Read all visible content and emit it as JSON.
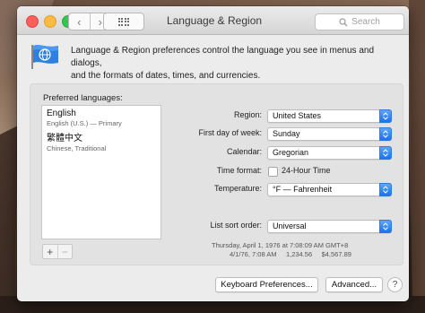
{
  "window": {
    "title": "Language & Region"
  },
  "titlebar": {
    "back_glyph": "‹",
    "forward_glyph": "›",
    "search_placeholder": "Search"
  },
  "intro": {
    "line1": "Language & Region preferences control the language you see in menus and dialogs,",
    "line2": "and the formats of dates, times, and currencies."
  },
  "preferred_languages": {
    "title": "Preferred languages:",
    "items": [
      {
        "name": "English",
        "detail": "English (U.S.) — Primary"
      },
      {
        "name": "繁體中文",
        "detail": "Chinese, Traditional"
      }
    ],
    "add_label": "+",
    "remove_label": "−"
  },
  "settings": {
    "region_label": "Region:",
    "region_value": "United States",
    "first_day_label": "First day of week:",
    "first_day_value": "Sunday",
    "calendar_label": "Calendar:",
    "calendar_value": "Gregorian",
    "time_format_label": "Time format:",
    "time_format_checkbox": "24-Hour Time",
    "time_format_checked": false,
    "temperature_label": "Temperature:",
    "temperature_value": "°F — Fahrenheit",
    "sort_order_label": "List sort order:",
    "sort_order_value": "Universal"
  },
  "sample": {
    "line1": "Thursday, April 1, 1976 at 7:08:09 AM GMT+8",
    "line2": "4/1/76, 7:08 AM     1,234.56     $4,567.89"
  },
  "footer": {
    "keyboard_button": "Keyboard Preferences...",
    "advanced_button": "Advanced...",
    "help_label": "?"
  },
  "colors": {
    "accent": "#1873f0",
    "window_bg": "#ececec",
    "panel_bg": "#e2e2e2"
  }
}
